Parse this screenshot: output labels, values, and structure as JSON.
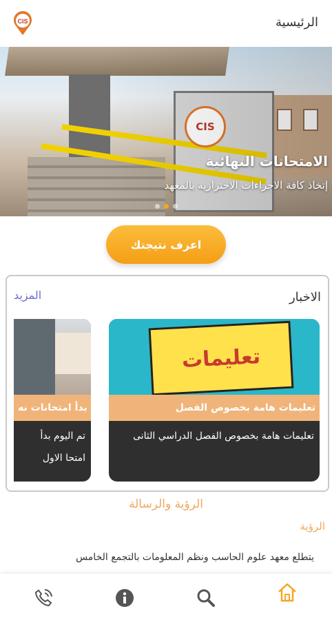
{
  "header": {
    "title": "الرئيسية",
    "logo_text": "CIS"
  },
  "hero": {
    "title": "الامتحانات النهائية",
    "subtitle": "إتخاذ كافة الاجراءات الاحترازية بالمعهد",
    "dots_count": 3,
    "active_dot": 2
  },
  "result_button": {
    "label": "اعرف نتيجتك"
  },
  "news": {
    "title": "الاخبار",
    "more_label": "المزيد",
    "items": [
      {
        "image_text": "تعليمات",
        "headline": "تعليمات هامة بخصوص الفصل",
        "description": "تعليمات هامة بخصوص الفصل الدراسي الثانى"
      },
      {
        "headline": "بدأ امتحانات نه",
        "description": "تم اليوم بدأ امتحا الاول"
      }
    ]
  },
  "vision": {
    "section_title": "الرؤية والرسالة",
    "label": "الرؤية",
    "text": "يتطلع معهد علوم الحاسب ونظم المعلومات بالتجمع الخامس"
  },
  "bottom_nav": [
    "phone-icon",
    "info-icon",
    "search-icon",
    "home-icon"
  ],
  "colors": {
    "accent": "#f5a623",
    "link": "#6b6bd6",
    "orange_text": "#f0a860"
  }
}
